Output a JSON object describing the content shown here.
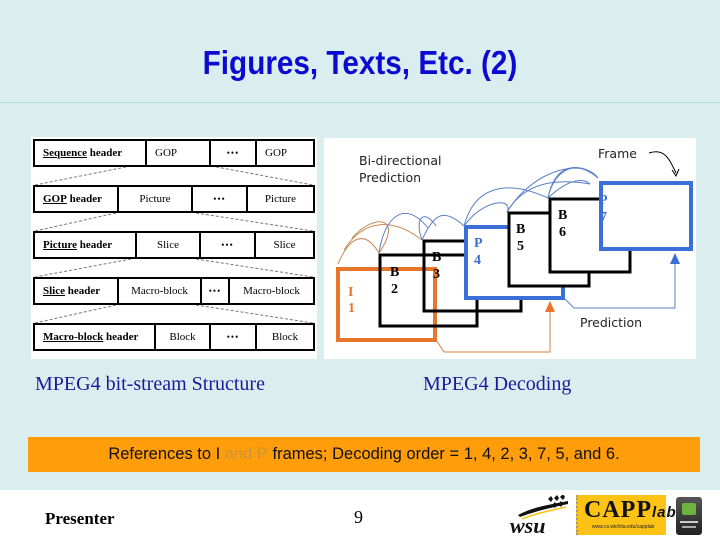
{
  "slide": {
    "title": "Figures, Texts, Etc. (2)",
    "page_number": "9",
    "presenter": "Presenter"
  },
  "bitstream_figure": {
    "rows": [
      {
        "header_underlined": "Sequence",
        "header_rest": " header",
        "cells": [
          "GOP",
          "•••",
          "GOP"
        ]
      },
      {
        "header_underlined": "GOP",
        "header_rest": " header",
        "cells": [
          "Picture",
          "•••",
          "Picture"
        ]
      },
      {
        "header_underlined": "Picture",
        "header_rest": " header",
        "cells": [
          "Slice",
          "•••",
          "Slice"
        ]
      },
      {
        "header_underlined": "Slice",
        "header_rest": " header",
        "cells": [
          "Macro-block",
          "•••",
          "Macro-block"
        ]
      },
      {
        "header_underlined": "Macro-block",
        "header_rest": " header",
        "cells": [
          "Block",
          "•••",
          "Block"
        ]
      }
    ],
    "caption": "MPEG4 bit-stream Structure"
  },
  "decoding_figure": {
    "label_bidirectional_line1": "Bi-directional",
    "label_bidirectional_line2": "Prediction",
    "label_frame": "Frame",
    "label_prediction": "Prediction",
    "frames": [
      {
        "type": "I",
        "num": "1",
        "color": "#e8762a"
      },
      {
        "type": "B",
        "num": "2",
        "color": "#000000"
      },
      {
        "type": "B",
        "num": "3",
        "color": "#000000"
      },
      {
        "type": "P",
        "num": "4",
        "color": "#3a6fd8"
      },
      {
        "type": "B",
        "num": "5",
        "color": "#000000"
      },
      {
        "type": "B",
        "num": "6",
        "color": "#000000"
      },
      {
        "type": "P",
        "num": "7",
        "color": "#3a6fd8"
      }
    ],
    "caption": "MPEG4 Decoding"
  },
  "banner": {
    "part1": "References to I ",
    "part2": "and P",
    "part3": " frames; Decoding order = 1, 4, 2, 3, 7, 5, and 6.",
    "background": "#ff9d0a"
  },
  "logos": {
    "wsu": "wsu-logo",
    "capp_title": "CAPP",
    "capp_suffix": "lab",
    "capp_sub": "www.cs.wichita.edu/capplab",
    "nvidia": "nvidia-logo"
  },
  "colors": {
    "title": "#0a0ad0",
    "caption": "#1a1a9a",
    "i_frame": "#e8762a",
    "p_frame": "#3a6fd8"
  }
}
